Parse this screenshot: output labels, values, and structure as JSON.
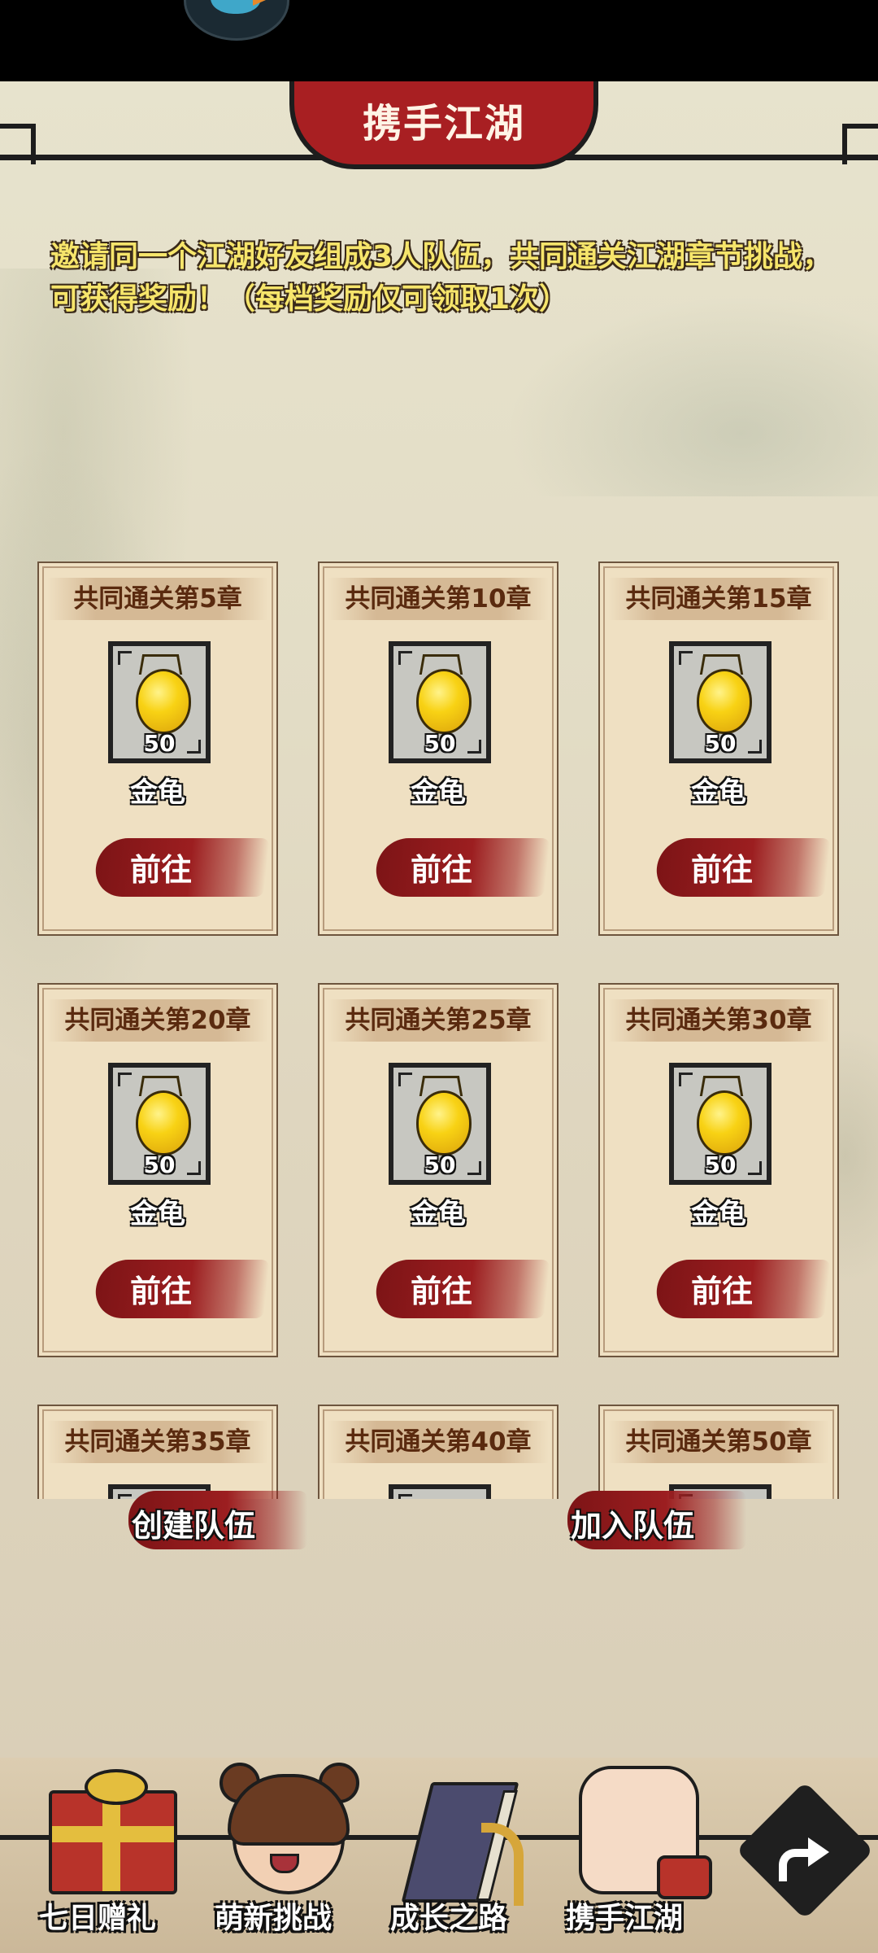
{
  "header": {
    "title": "携手江湖"
  },
  "intro": {
    "line1": "邀请同一个江湖好友组成3人队伍，共同通关江湖章节挑战，",
    "line2": "可获得奖励！（每档奖励仅可领取1次）"
  },
  "rewards": [
    {
      "title": "共同通关第5章",
      "item_name": "金龟",
      "quantity": "50",
      "button_label": "前往"
    },
    {
      "title": "共同通关第10章",
      "item_name": "金龟",
      "quantity": "50",
      "button_label": "前往"
    },
    {
      "title": "共同通关第15章",
      "item_name": "金龟",
      "quantity": "50",
      "button_label": "前往"
    },
    {
      "title": "共同通关第20章",
      "item_name": "金龟",
      "quantity": "50",
      "button_label": "前往"
    },
    {
      "title": "共同通关第25章",
      "item_name": "金龟",
      "quantity": "50",
      "button_label": "前往"
    },
    {
      "title": "共同通关第30章",
      "item_name": "金龟",
      "quantity": "50",
      "button_label": "前往"
    },
    {
      "title": "共同通关第35章"
    },
    {
      "title": "共同通关第40章"
    },
    {
      "title": "共同通关第50章"
    }
  ],
  "actions": {
    "create_team": "创建队伍",
    "join_team": "加入队伍"
  },
  "bottom_nav": [
    {
      "label": "七日赠礼",
      "icon": "gift-box-icon"
    },
    {
      "label": "萌新挑战",
      "icon": "girl-avatar-icon"
    },
    {
      "label": "成长之路",
      "icon": "book-arrow-icon"
    },
    {
      "label": "携手江湖",
      "icon": "handshake-icon"
    }
  ],
  "colors": {
    "accent_red": "#a81f22",
    "intro_text": "#f6e56b",
    "card_bg": "#efe0c2"
  }
}
